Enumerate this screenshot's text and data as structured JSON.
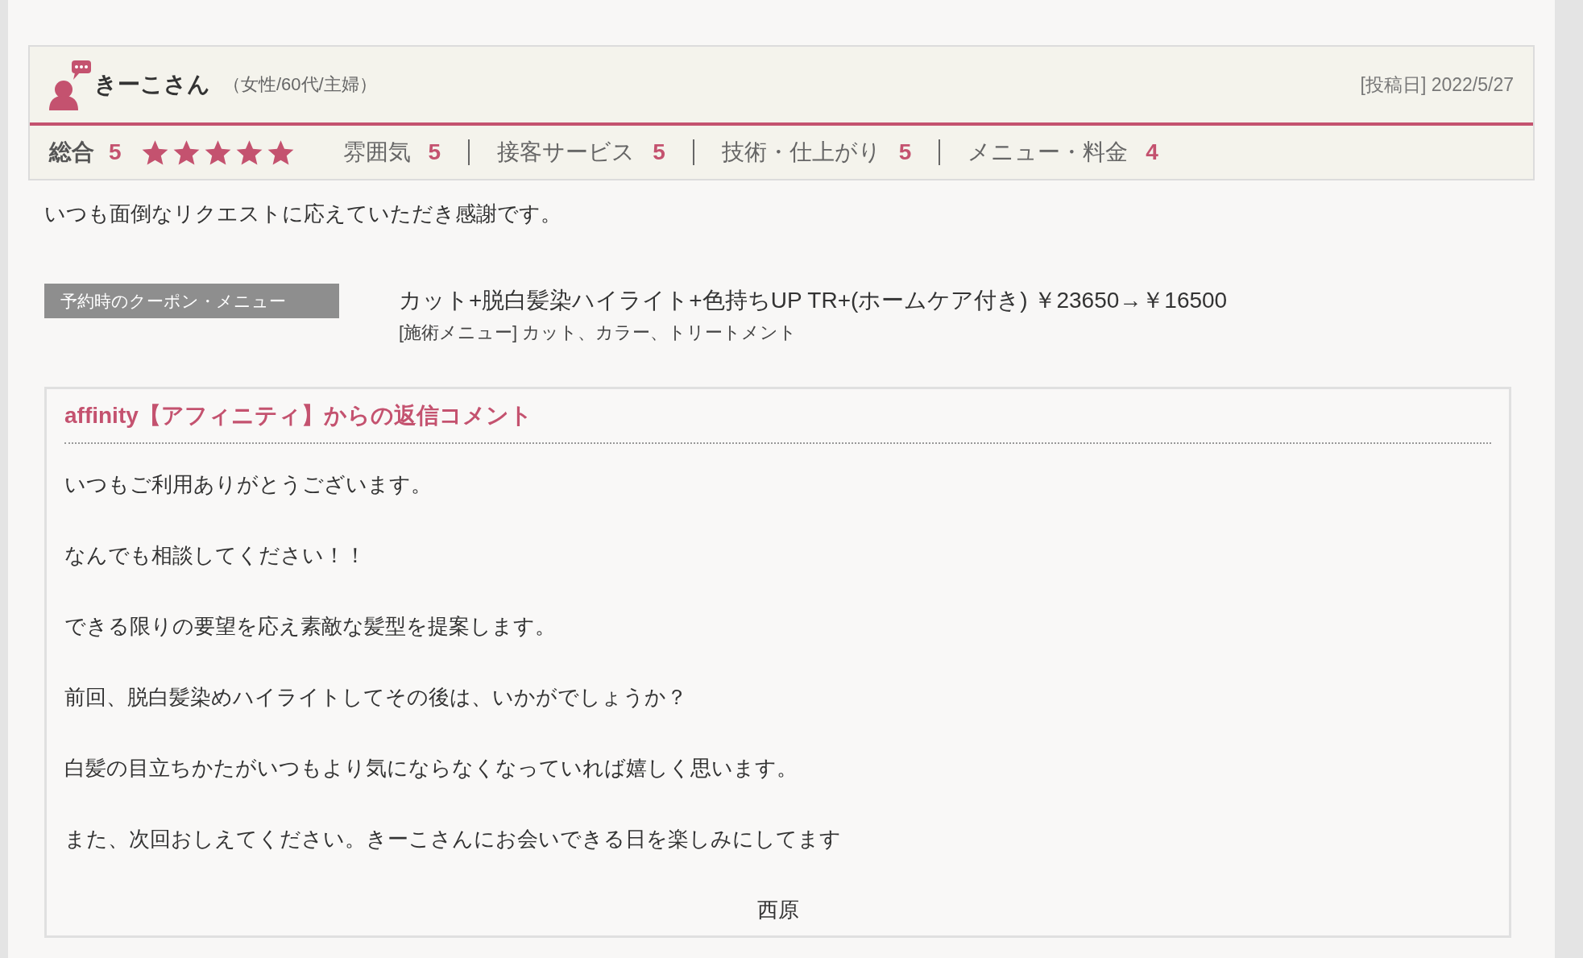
{
  "reviewer": {
    "name": "きーこさん",
    "profile": "（女性/60代/主婦）",
    "posted": "[投稿日] 2022/5/27"
  },
  "ratings": {
    "overall_label": "総合",
    "overall_score": "5",
    "stars": 5,
    "categories": [
      {
        "label": "雰囲気",
        "score": "5"
      },
      {
        "label": "接客サービス",
        "score": "5"
      },
      {
        "label": "技術・仕上がり",
        "score": "5"
      },
      {
        "label": "メニュー・料金",
        "score": "4"
      }
    ]
  },
  "comment": "いつも面倒なリクエストに応えていただき感謝です。",
  "coupon": {
    "label": "予約時のクーポン・メニュー",
    "title": "カット+脱白髪染ハイライト+色持ちUP TR+(ホームケア付き) ￥23650→￥16500",
    "menu": "[施術メニュー] カット、カラー、トリートメント"
  },
  "reply": {
    "title": "affinity【アフィニティ】からの返信コメント",
    "paragraphs": [
      "いつもご利用ありがとうございます。",
      "なんでも相談してください！！",
      "できる限りの要望を応え素敵な髪型を提案します。",
      "前回、脱白髪染めハイライトしてその後は、いかがでしょうか？",
      "白髪の目立ちかたがいつもより気にならなくなっていれば嬉しく思います。",
      "また、次回おしえてください。きーこさんにお会いできる日を楽しみにしてます"
    ],
    "signature": "西原"
  }
}
